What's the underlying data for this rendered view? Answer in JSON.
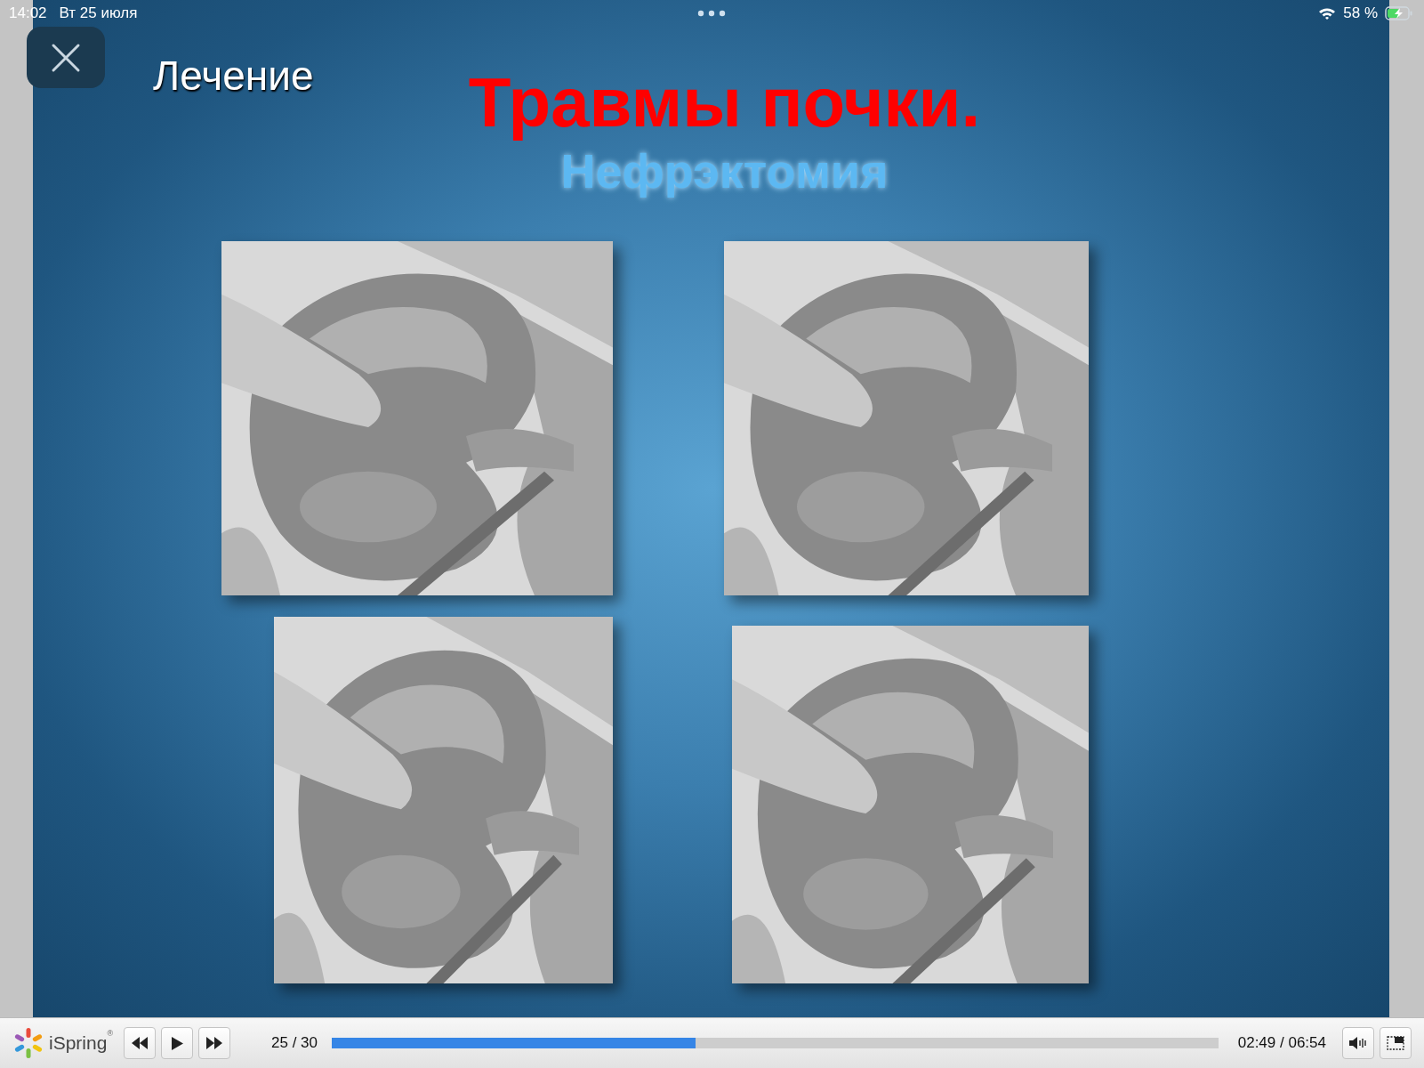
{
  "status_bar": {
    "time": "14:02",
    "date": "Вт 25 июля",
    "battery": "58 %"
  },
  "slide": {
    "section": "Лечение",
    "title": "Травмы почки.",
    "subtitle": "Нефрэктомия"
  },
  "player": {
    "logo": "iSpring",
    "logo_mark": "®",
    "slide_counter": "25 / 30",
    "progress": {
      "level": 0.41
    },
    "time": "02:49 / 06:54"
  }
}
